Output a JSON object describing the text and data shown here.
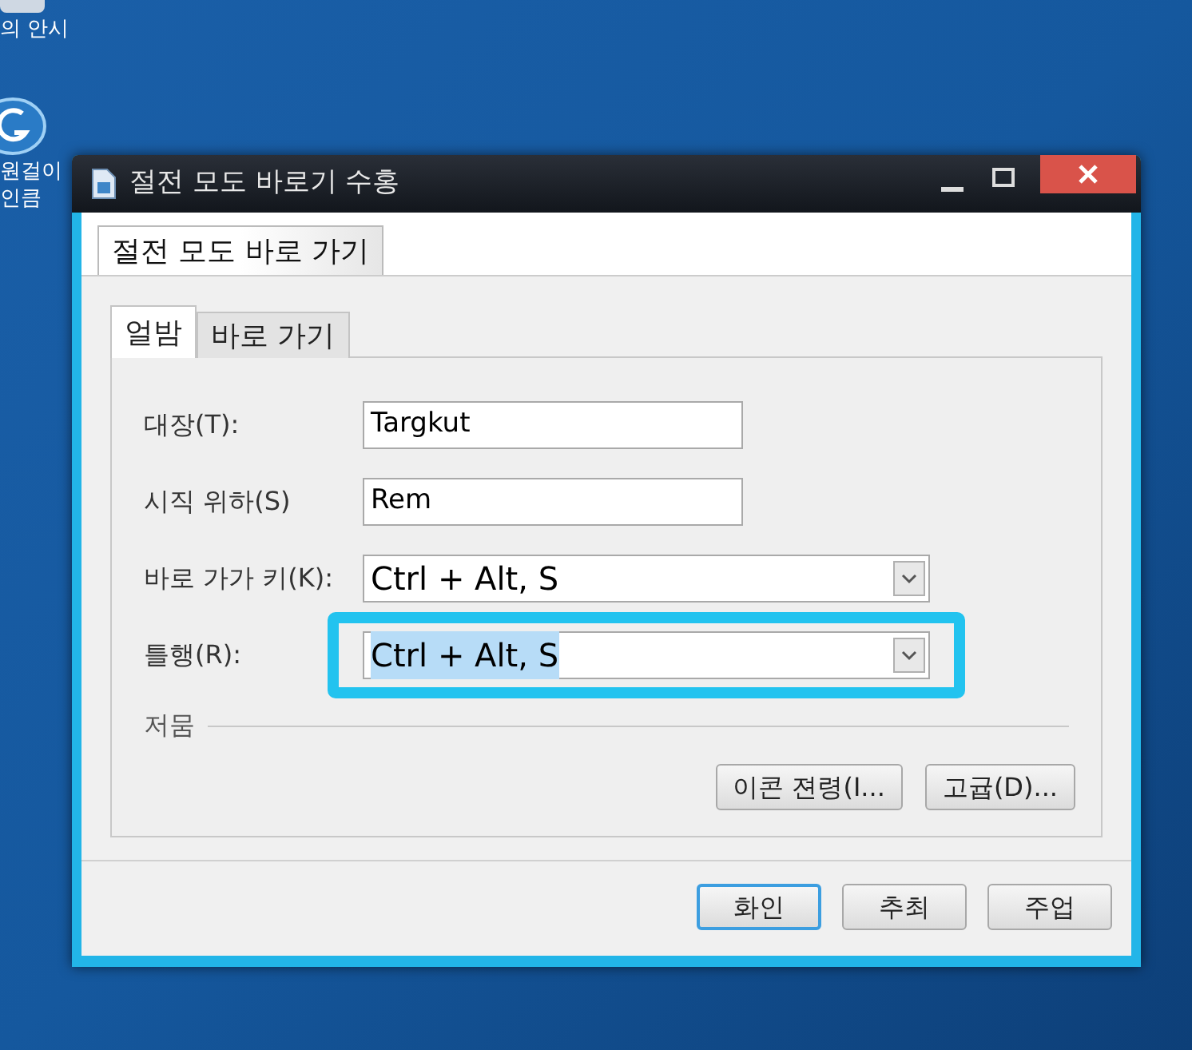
{
  "desktop_icons": [
    {
      "lines": [
        "의 안시"
      ]
    },
    {
      "lines": [
        "원걸이",
        "인큼"
      ]
    }
  ],
  "window": {
    "title": "절전 모도 바로기 수홍"
  },
  "outer_tabs": [
    {
      "label": "절전 모도 바로 가기",
      "selected": true
    }
  ],
  "tabs": [
    {
      "label": "얼밤",
      "selected": true
    },
    {
      "label": "바로 가기",
      "selected": false
    }
  ],
  "fields": [
    {
      "kind": "text",
      "label": "대장(T):",
      "value": "Targkut",
      "highlighted": false,
      "text_selected": false
    },
    {
      "kind": "text",
      "label": "시직 위하(S)",
      "value": "Rem",
      "highlighted": false,
      "text_selected": false
    },
    {
      "kind": "combo",
      "label": "바로 가가 키(K):",
      "value": "Ctrl + Alt, S",
      "highlighted": false,
      "text_selected": false
    },
    {
      "kind": "combo",
      "label": "틀행(R):",
      "value": "Ctrl + Alt, S",
      "highlighted": true,
      "text_selected": true
    }
  ],
  "section": {
    "title": "저뭄",
    "buttons": [
      "이콘 젼령(I...",
      "고귭(D)..."
    ]
  },
  "dialog_buttons": [
    {
      "label": "화인",
      "default": true
    },
    {
      "label": "추최",
      "default": false
    },
    {
      "label": "주업",
      "default": false
    }
  ]
}
